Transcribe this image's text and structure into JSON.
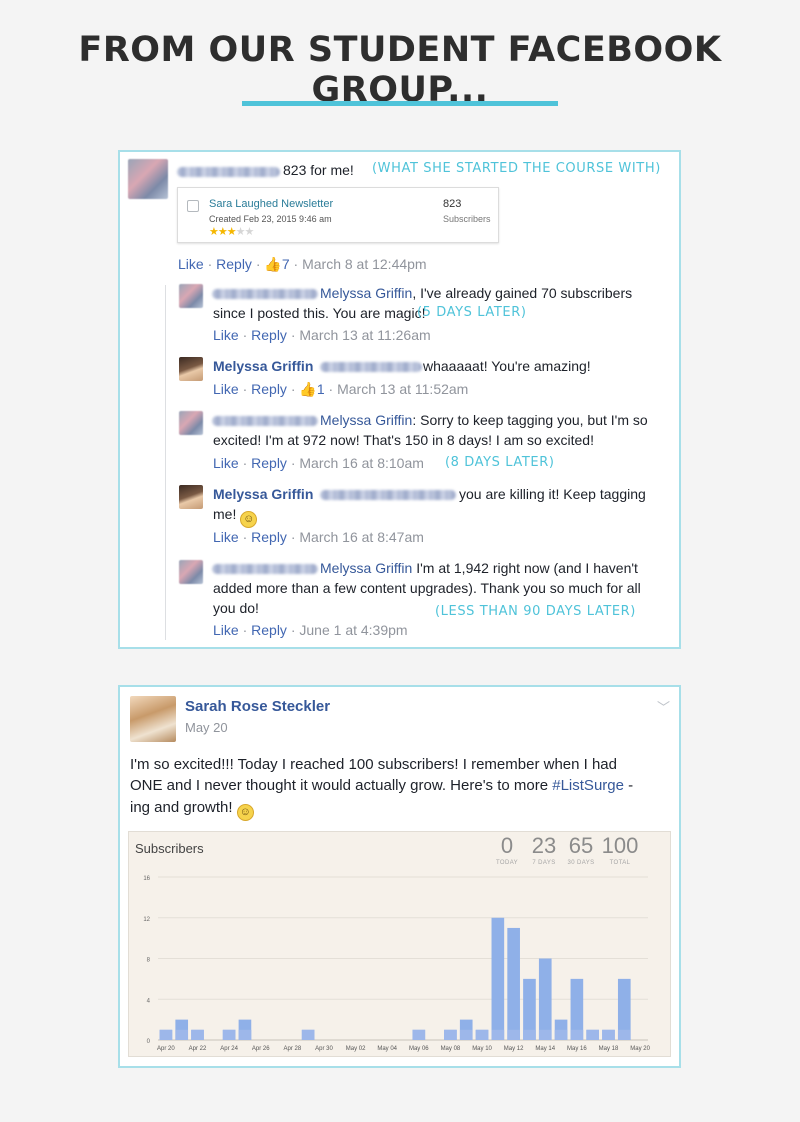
{
  "headline": "FROM OUR STUDENT FACEBOOK GROUP...",
  "colors": {
    "accent": "#4fc3d9",
    "link": "#365899",
    "bar": "#8fb0e8"
  },
  "thread": {
    "post": {
      "text": "823 for me!",
      "note": "(WHAT SHE STARTED THE COURSE WITH)",
      "newsletter": {
        "name": "Sara Laughed Newsletter",
        "created": "Created Feb 23, 2015 9:46 am",
        "count": "823",
        "count_label": "Subscribers",
        "stars": 3
      },
      "like": "Like",
      "reply": "Reply",
      "likes": "7",
      "date": "March 8 at 12:44pm"
    },
    "replies": [
      {
        "mention": "Melyssa Griffin",
        "line1": ", I've already gained 70 subscribers",
        "line2": "since I posted this. You are magic!",
        "note": "(5 DAYS LATER)",
        "like": "Like",
        "reply": "Reply",
        "date": "March 13 at 11:26am"
      },
      {
        "author": "Melyssa Griffin",
        "text": "whaaaaat! You're amazing!",
        "like": "Like",
        "reply": "Reply",
        "likes": "1",
        "date": "March 13 at 11:52am"
      },
      {
        "mention": "Melyssa Griffin",
        "line1": ": Sorry to keep tagging you, but I'm so",
        "line2": "excited! I'm at 972 now! That's 150 in 8 days! I am so excited!",
        "note": "(8 DAYS LATER)",
        "like": "Like",
        "reply": "Reply",
        "date": "March 16 at 8:10am"
      },
      {
        "author": "Melyssa Griffin",
        "line1": "you are killing it! Keep tagging",
        "line2": "me!",
        "like": "Like",
        "reply": "Reply",
        "date": "March 16 at 8:47am"
      },
      {
        "mention": "Melyssa Griffin",
        "line1": " I'm at 1,942 right now (and I haven't",
        "line2": "added more than a few content upgrades). Thank you so much for all",
        "line3": "you do!",
        "note": "(LESS THAN 90 DAYS LATER)",
        "like": "Like",
        "reply": "Reply",
        "date": "June 1 at 4:39pm"
      }
    ]
  },
  "post2": {
    "author": "Sarah Rose Steckler",
    "date": "May 20",
    "line1": "I'm so excited!!! Today I reached 100 subscribers! I remember when I had",
    "line2a": "ONE and I never thought it would actually grow. Here's to more ",
    "hashtag": "#ListSurge",
    "line2b": " -",
    "line3": "ing and growth!",
    "stats": [
      {
        "value": "0",
        "label": "TODAY"
      },
      {
        "value": "23",
        "label": "7 DAYS"
      },
      {
        "value": "65",
        "label": "30 DAYS"
      },
      {
        "value": "100",
        "label": "TOTAL"
      }
    ]
  },
  "chart_data": {
    "type": "bar",
    "title": "Subscribers",
    "ylim": [
      0,
      16
    ],
    "yticks": [
      0,
      4,
      8,
      12,
      16
    ],
    "xtick_labels": [
      "Apr 20",
      "Apr 22",
      "Apr 24",
      "Apr 26",
      "Apr 28",
      "Apr 30",
      "May 02",
      "May 04",
      "May 06",
      "May 08",
      "May 10",
      "May 12",
      "May 14",
      "May 16",
      "May 18",
      "May 20"
    ],
    "categories": [
      "Apr 20",
      "Apr 21",
      "Apr 22",
      "Apr 23",
      "Apr 24",
      "Apr 25",
      "Apr 26",
      "Apr 27",
      "Apr 28",
      "Apr 29",
      "Apr 30",
      "May 01",
      "May 02",
      "May 03",
      "May 04",
      "May 05",
      "May 06",
      "May 07",
      "May 08",
      "May 09",
      "May 10",
      "May 11",
      "May 12",
      "May 13",
      "May 14",
      "May 15",
      "May 16",
      "May 17",
      "May 18",
      "May 19",
      "May 20"
    ],
    "values": [
      1,
      2,
      1,
      0,
      1,
      2,
      0,
      0,
      0,
      1,
      0,
      0,
      0,
      0,
      0,
      0,
      1,
      0,
      1,
      2,
      1,
      12,
      11,
      6,
      8,
      2,
      6,
      1,
      1,
      6,
      0
    ],
    "grid": true
  }
}
